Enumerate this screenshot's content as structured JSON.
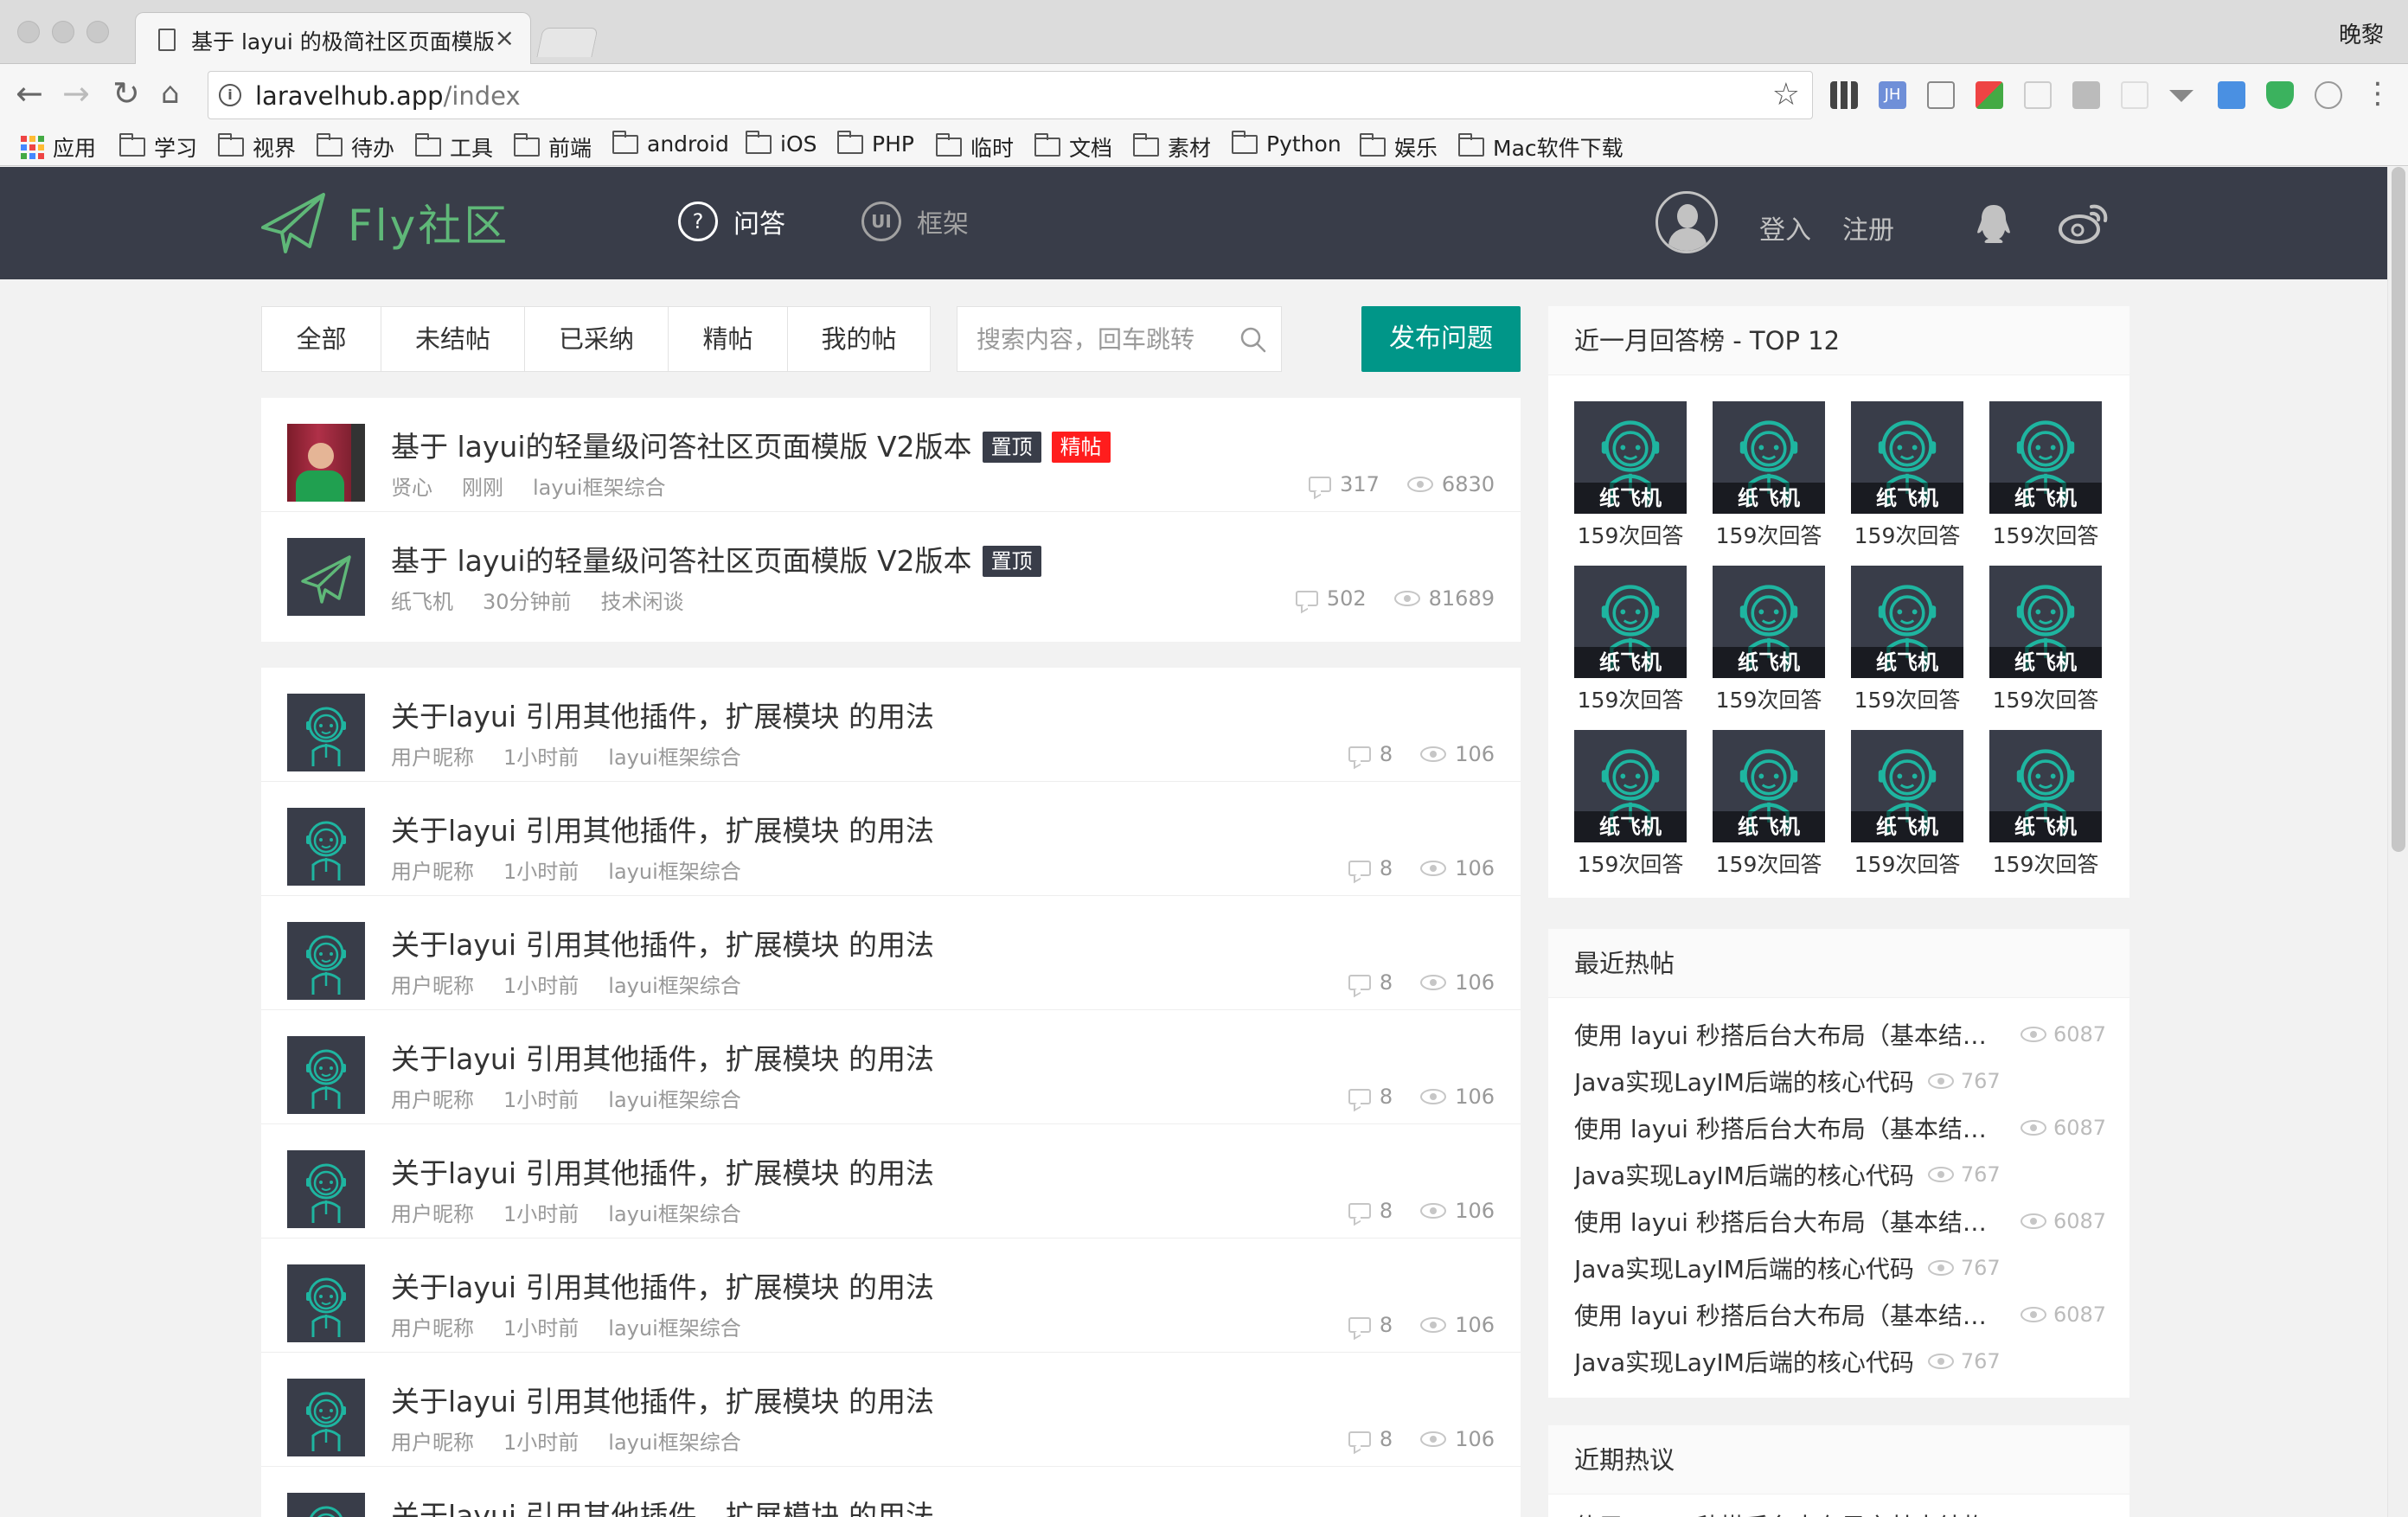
{
  "browser": {
    "tab_title": "基于 layui 的极简社区页面模版",
    "profile_name": "晚黎",
    "url_host": "laravelhub.app",
    "url_path": "/index",
    "bookmarks": [
      "应用",
      "学习",
      "视界",
      "待办",
      "工具",
      "前端",
      "android",
      "iOS",
      "PHP",
      "临时",
      "文档",
      "素材",
      "Python",
      "娱乐",
      "Mac软件下载"
    ]
  },
  "header": {
    "logo_text": "Fly社区",
    "nav": [
      {
        "label": "问答",
        "icon": "question-icon"
      },
      {
        "label": "框架",
        "icon": "ui-icon"
      }
    ],
    "login": "登入",
    "register": "注册"
  },
  "filters": {
    "tabs": [
      "全部",
      "未结帖",
      "已采纳",
      "精帖",
      "我的帖"
    ],
    "search_placeholder": "搜索内容，回车跳转",
    "post_button": "发布问题"
  },
  "top_posts": [
    {
      "title": "基于 layui的轻量级问答社区页面模版 V2版本",
      "badges": [
        "置顶",
        "精帖"
      ],
      "author": "贤心",
      "time": "刚刚",
      "category": "layui框架综合",
      "comments": "317",
      "views": "6830",
      "avatar": "photo"
    },
    {
      "title": "基于 layui的轻量级问答社区页面模版 V2版本",
      "badges": [
        "置顶"
      ],
      "author": "纸飞机",
      "time": "30分钟前",
      "category": "技术闲谈",
      "comments": "502",
      "views": "81689",
      "avatar": "plane"
    }
  ],
  "posts": [
    {
      "title": "关于layui 引用其他插件，扩展模块 的用法",
      "author": "用户昵称",
      "time": "1小时前",
      "category": "layui框架综合",
      "comments": "8",
      "views": "106"
    },
    {
      "title": "关于layui 引用其他插件，扩展模块 的用法",
      "author": "用户昵称",
      "time": "1小时前",
      "category": "layui框架综合",
      "comments": "8",
      "views": "106"
    },
    {
      "title": "关于layui 引用其他插件，扩展模块 的用法",
      "author": "用户昵称",
      "time": "1小时前",
      "category": "layui框架综合",
      "comments": "8",
      "views": "106"
    },
    {
      "title": "关于layui 引用其他插件，扩展模块 的用法",
      "author": "用户昵称",
      "time": "1小时前",
      "category": "layui框架综合",
      "comments": "8",
      "views": "106"
    },
    {
      "title": "关于layui 引用其他插件，扩展模块 的用法",
      "author": "用户昵称",
      "time": "1小时前",
      "category": "layui框架综合",
      "comments": "8",
      "views": "106"
    },
    {
      "title": "关于layui 引用其他插件，扩展模块 的用法",
      "author": "用户昵称",
      "time": "1小时前",
      "category": "layui框架综合",
      "comments": "8",
      "views": "106"
    },
    {
      "title": "关于layui 引用其他插件，扩展模块 的用法",
      "author": "用户昵称",
      "time": "1小时前",
      "category": "layui框架综合",
      "comments": "8",
      "views": "106"
    },
    {
      "title": "关于layui 引用其他插件，扩展模块 的用法",
      "author": "",
      "time": "",
      "category": "",
      "comments": "",
      "views": ""
    }
  ],
  "sidebar": {
    "rank_title": "近一月回答榜 - TOP 12",
    "rank": [
      {
        "name": "纸飞机",
        "count": "159次回答"
      },
      {
        "name": "纸飞机",
        "count": "159次回答"
      },
      {
        "name": "纸飞机",
        "count": "159次回答"
      },
      {
        "name": "纸飞机",
        "count": "159次回答"
      },
      {
        "name": "纸飞机",
        "count": "159次回答"
      },
      {
        "name": "纸飞机",
        "count": "159次回答"
      },
      {
        "name": "纸飞机",
        "count": "159次回答"
      },
      {
        "name": "纸飞机",
        "count": "159次回答"
      },
      {
        "name": "纸飞机",
        "count": "159次回答"
      },
      {
        "name": "纸飞机",
        "count": "159次回答"
      },
      {
        "name": "纸飞机",
        "count": "159次回答"
      },
      {
        "name": "纸飞机",
        "count": "159次回答"
      }
    ],
    "hot_title": "最近热帖",
    "hot": [
      {
        "title": "使用 layui 秒搭后台大布局（基本结构）",
        "views": "6087"
      },
      {
        "title": "Java实现LayIM后端的核心代码",
        "views": "767"
      },
      {
        "title": "使用 layui 秒搭后台大布局（基本结构）",
        "views": "6087"
      },
      {
        "title": "Java实现LayIM后端的核心代码",
        "views": "767"
      },
      {
        "title": "使用 layui 秒搭后台大布局（基本结构）",
        "views": "6087"
      },
      {
        "title": "Java实现LayIM后端的核心代码",
        "views": "767"
      },
      {
        "title": "使用 layui 秒搭后台大布局（基本结构）",
        "views": "6087"
      },
      {
        "title": "Java实现LayIM后端的核心代码",
        "views": "767"
      }
    ],
    "recent_title": "近期热议",
    "recent_first": "使用 layui 秒搭后台大布局之基本结构"
  },
  "colors": {
    "header_bg": "#393d49",
    "accent": "#009688",
    "logo": "#5fb878",
    "badge_top": "#393d49",
    "badge_best": "#ff1d1d"
  }
}
